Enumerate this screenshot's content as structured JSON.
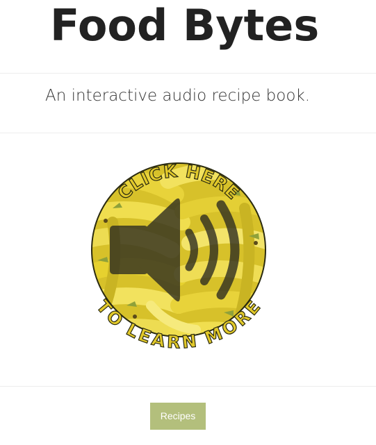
{
  "header": {
    "title": "Food Bytes",
    "subtitle": "An interactive audio recipe book."
  },
  "badge": {
    "top_text": "CLICK HERE",
    "bottom_text": "TO LEARN MORE",
    "icon": "speaker-volume-icon",
    "background": "bananas",
    "colors": {
      "text_fill": "#e2c92a",
      "text_stroke": "#2a2a10",
      "banana_yellow": "#e6d12f",
      "banana_light": "#f3e46a",
      "banana_green": "#8fa13a",
      "speaker": "#2b2a20"
    }
  },
  "nav": {
    "recipes_label": "Recipes"
  },
  "colors": {
    "title": "#222222",
    "button_bg": "#b3bf7c",
    "button_text": "#ffffff",
    "rule": "#ececec"
  }
}
